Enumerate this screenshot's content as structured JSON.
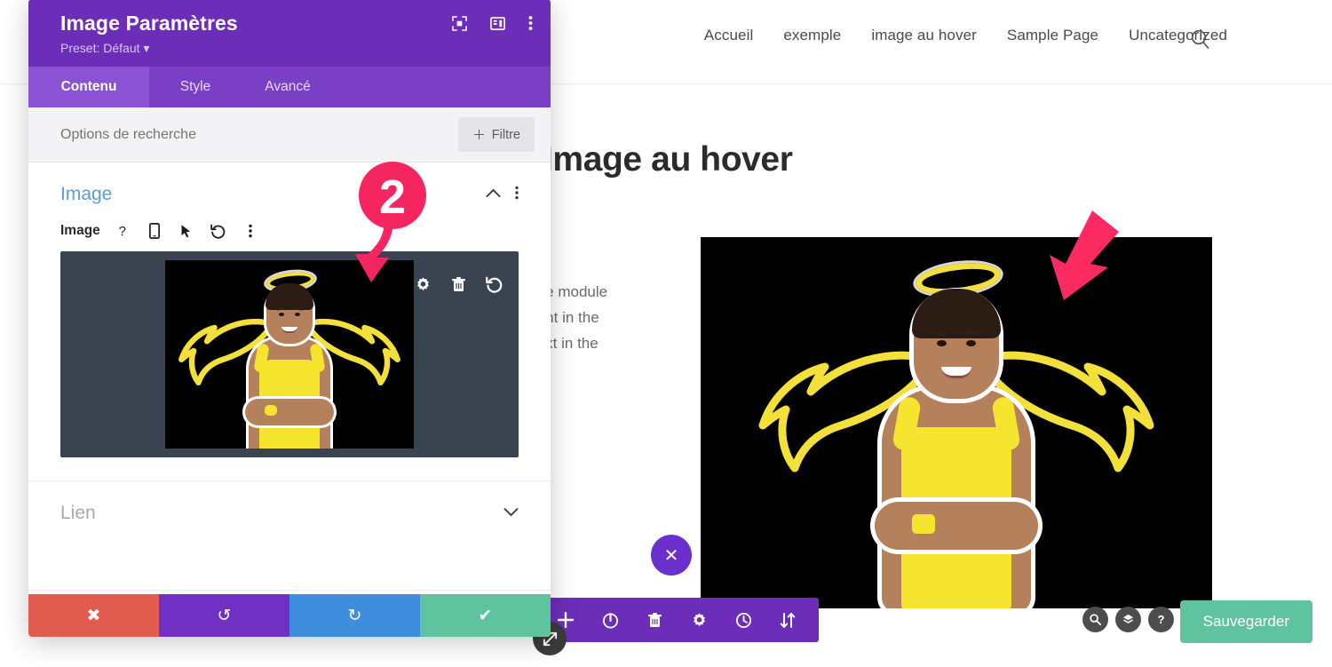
{
  "site": {
    "nav": {
      "items": [
        {
          "label": "Accueil"
        },
        {
          "label": "exemple"
        },
        {
          "label": "image au hover"
        },
        {
          "label": "Sample Page"
        },
        {
          "label": "Uncategorized"
        }
      ],
      "search_icon": "search-icon"
    },
    "page_title": "Image au hover",
    "body_lines": [
      "the module",
      "tent in the",
      "text in the"
    ],
    "close_button_label": "✕",
    "save_button_label": "Sauvegarder",
    "util_circles": [
      {
        "name": "zoom-icon",
        "glyph": "⚲"
      },
      {
        "name": "layers-icon",
        "glyph": "◆"
      },
      {
        "name": "help-icon",
        "glyph": "?"
      }
    ],
    "toolbar_icons": [
      {
        "name": "add-icon"
      },
      {
        "name": "power-icon"
      },
      {
        "name": "trash-icon"
      },
      {
        "name": "gear-icon"
      },
      {
        "name": "history-clock-icon"
      },
      {
        "name": "sort-arrows-icon"
      }
    ],
    "resize_handle_icon": "resize-handle-icon"
  },
  "modal": {
    "title": "Image Paramètres",
    "preset_label": "Preset: Défaut",
    "header_icons": [
      {
        "name": "fullscreen-icon"
      },
      {
        "name": "layout-panel-icon"
      },
      {
        "name": "more-vertical-icon"
      }
    ],
    "tabs": [
      {
        "label": "Contenu",
        "active": true
      },
      {
        "label": "Style",
        "active": false
      },
      {
        "label": "Avancé",
        "active": false
      }
    ],
    "search": {
      "placeholder": "Options de recherche",
      "value": "",
      "filter_button_label": "Filtre",
      "filter_button_glyph": "＋"
    },
    "sections": [
      {
        "title": "Image",
        "expanded": true,
        "field": {
          "label": "Image",
          "icons": [
            {
              "name": "help-icon",
              "glyph": "?"
            },
            {
              "name": "mobile-responsive-icon"
            },
            {
              "name": "hover-cursor-icon"
            },
            {
              "name": "reset-undo-icon"
            },
            {
              "name": "more-vertical-icon"
            }
          ]
        },
        "preview_actions": [
          {
            "name": "gear-icon"
          },
          {
            "name": "trash-icon"
          },
          {
            "name": "reset-undo-icon"
          }
        ]
      },
      {
        "title": "Lien",
        "expanded": false
      }
    ],
    "footer_buttons": [
      {
        "name": "cancel-button",
        "glyph": "✖",
        "color": "#e15b4f"
      },
      {
        "name": "undo-button",
        "glyph": "↺",
        "color": "#7130c4"
      },
      {
        "name": "redo-button",
        "glyph": "↻",
        "color": "#3e8edd"
      },
      {
        "name": "confirm-save-button",
        "glyph": "✔",
        "color": "#5fc3a0"
      }
    ]
  },
  "annotations": {
    "step_marker": "2",
    "marker_color": "#f5265f",
    "hero_arrow_color": "#fb2b62"
  },
  "colors": {
    "modal_header_purple": "#6c2eb9",
    "modal_tabs_purple": "#7a3fc4",
    "active_tab_purple": "#8b53d4",
    "divi_toolbar_purple": "#6c2eb9",
    "save_green": "#5fc3a0",
    "section_title_blue": "#5b9dd9",
    "preview_bg": "#3a4450"
  }
}
